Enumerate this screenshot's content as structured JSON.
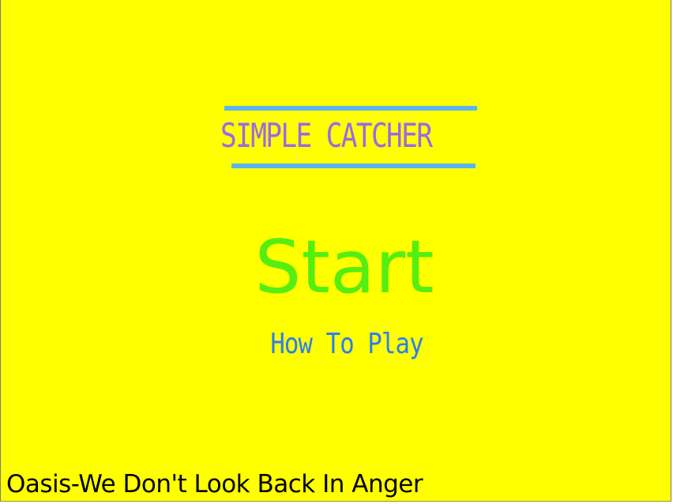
{
  "game": {
    "title": "SIMPLE CATCHER",
    "colors": {
      "background": "#ffff00",
      "title_text": "#9a6ae6",
      "title_bars": "#5ab4f0",
      "start_text": "#55ee11",
      "how_to_play_text": "#2a7ef0",
      "now_playing_text": "#000000"
    }
  },
  "menu": {
    "start_label": "Start",
    "how_to_play_label": "How To Play"
  },
  "music": {
    "now_playing": "Oasis-We Don't Look Back In Anger"
  }
}
